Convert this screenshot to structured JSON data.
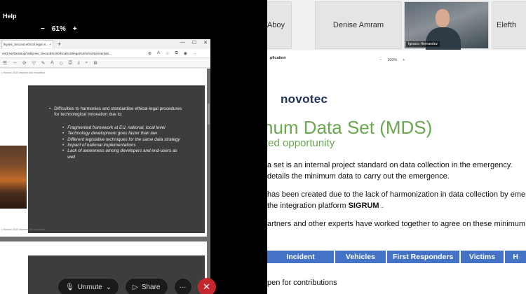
{
  "meeting": {
    "menu_help": "Help",
    "zoom_minus": "−",
    "zoom_level": "61%",
    "zoom_plus": "+",
    "controls": {
      "unmute_label": "Unmute",
      "share_label": "Share",
      "more_label": "···",
      "end_label": "✕"
    }
  },
  "pdf_window": {
    "tab_title": "lkyries_Second ethical legal vi...",
    "tab_close": "×",
    "new_tab": "+",
    "url": "neDrive/Desktop/Valkyries_Second%20ethical%20legal%20vi%20presentati...",
    "page_header": "n Horizon 2020 research and innovation",
    "page_footer": "n Horizon 2020 research and innovation",
    "slide": {
      "lead": "Difficulties to harmonies and standardise ethical-legal procedures for technological innovation due to:",
      "subitems": [
        "Fragmented framework at EU, national, local level",
        "Technology development goes faster than law",
        "Different legislative techniques for the same data strategy",
        "Impact of national implementations",
        "Lack of awareness among developers and end-users as well"
      ]
    }
  },
  "participants": [
    {
      "name": "Aboy"
    },
    {
      "name": "Denise Amram"
    },
    {
      "name": "Ignacio Hernandez"
    },
    {
      "name": "Elefth"
    }
  ],
  "presentation": {
    "app_label": "plication",
    "zoom_minus": "−",
    "zoom_level": "100%",
    "zoom_plus": "+",
    "brand": "novotec",
    "title": "num Data Set (MDS)",
    "subtitle": "ted opportunity",
    "lines": [
      "a set is an internal project standard on data collection in the emergency.",
      "details the minimum data to carry out the emergence.",
      "has been created due to the lack of harmonization in data collection by emer",
      "the integration platform ",
      "artners and other experts have worked together to agree on these minimum"
    ],
    "platform_name": "SIGRUM",
    "platform_suffix": " .",
    "table_headers": [
      "Incident",
      "Vehicles",
      "First Responders",
      "Victims",
      "H"
    ],
    "contributions": "pen for contributions"
  },
  "colors": {
    "presenter_title_green": "#6aa84f",
    "brand_navy": "#1f2f5a",
    "table_blue": "#4472c4",
    "end_call_red": "#c4262e"
  }
}
